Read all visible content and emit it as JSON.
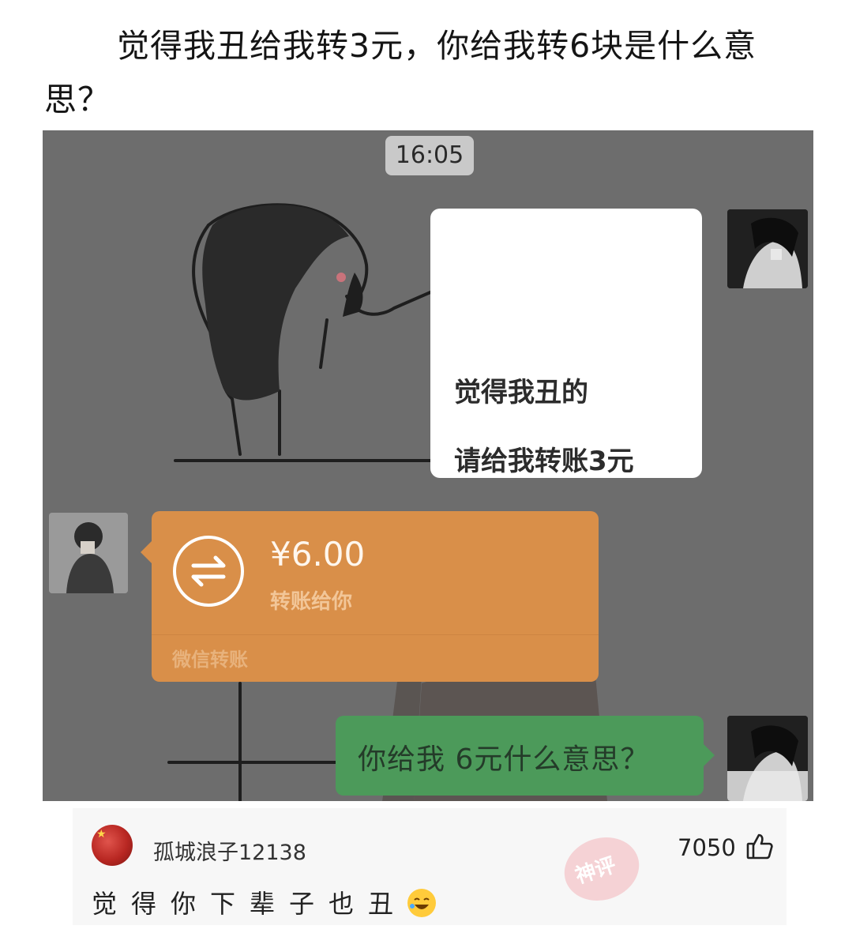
{
  "post": {
    "title": "觉得我丑给我转3元，你给我转6块是什么意思？"
  },
  "chat": {
    "time": "16:05",
    "white_bubble": {
      "line1": "觉得我丑的",
      "line2": "请给我转账3元"
    },
    "transfer": {
      "amount": "¥6.00",
      "description": "转账给你",
      "brand": "微信转账",
      "icon": "transfer-arrows-icon"
    },
    "green_bubble": {
      "text": "你给我 6元什么意思？"
    },
    "colors": {
      "background": "#6d6d6d",
      "transfer": "#d98f49",
      "green_bubble": "#4c9a5a"
    }
  },
  "comment": {
    "username": "孤城浪子12138",
    "likes": "7050",
    "text": "觉得你下辈子也丑",
    "emoji": "rolling-laughing-emoji",
    "stamp": "神评",
    "like_icon": "thumbs-up-icon"
  }
}
